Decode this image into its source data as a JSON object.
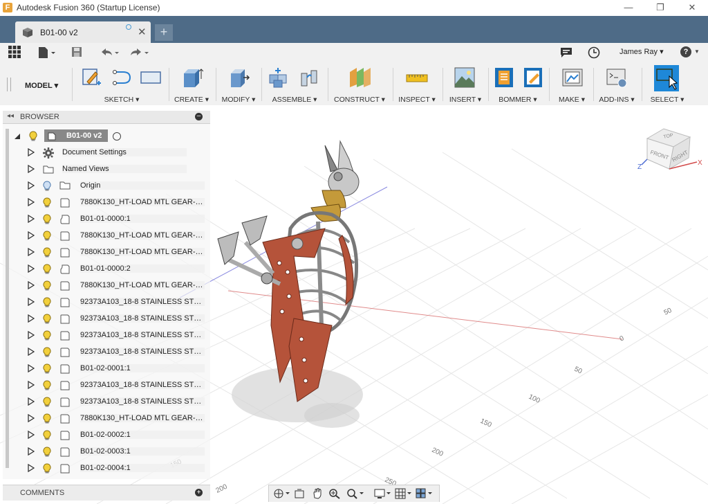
{
  "window": {
    "title": "Autodesk Fusion 360 (Startup License)",
    "app_letter": "F",
    "minimize": "—",
    "maximize": "❐",
    "close": "✕"
  },
  "tab": {
    "label": "B01-00 v2",
    "close": "✕",
    "new": "+"
  },
  "user": {
    "name": "James Ray ▾",
    "help": "?"
  },
  "workspace": {
    "label": "MODEL ▾"
  },
  "toolbar": {
    "sketch": "SKETCH ▾",
    "create": "CREATE ▾",
    "modify": "MODIFY ▾",
    "assemble": "ASSEMBLE ▾",
    "construct": "CONSTRUCT ▾",
    "inspect": "INSPECT ▾",
    "insert": "INSERT ▾",
    "bommer": "BOMMER ▾",
    "make": "MAKE ▾",
    "addins": "ADD-INS ▾",
    "select": "SELECT ▾"
  },
  "browser": {
    "title": "BROWSER",
    "root": "B01-00 v2",
    "items": [
      {
        "label": "Document Settings"
      },
      {
        "label": "Named Views"
      },
      {
        "label": "Origin"
      },
      {
        "label": "7880K130_HT-LOAD MTL GEAR--2..."
      },
      {
        "label": "B01-01-0000:1"
      },
      {
        "label": "7880K130_HT-LOAD MTL GEAR--2..."
      },
      {
        "label": "7880K130_HT-LOAD MTL GEAR--2..."
      },
      {
        "label": "B01-01-0000:2"
      },
      {
        "label": "7880K130_HT-LOAD MTL GEAR--2..."
      },
      {
        "label": "92373A103_18-8 STAINLESS STE..."
      },
      {
        "label": "92373A103_18-8 STAINLESS STE..."
      },
      {
        "label": "92373A103_18-8 STAINLESS STE..."
      },
      {
        "label": "92373A103_18-8 STAINLESS STE..."
      },
      {
        "label": "B01-02-0001:1"
      },
      {
        "label": "92373A103_18-8 STAINLESS STE..."
      },
      {
        "label": "92373A103_18-8 STAINLESS STE..."
      },
      {
        "label": "7880K130_HT-LOAD MTL GEAR--2..."
      },
      {
        "label": "B01-02-0002:1"
      },
      {
        "label": "B01-02-0003:1"
      },
      {
        "label": "B01-02-0004:1"
      }
    ]
  },
  "comments": {
    "title": "COMMENTS"
  },
  "viewcube": {
    "top": "TOP",
    "front": "FRONT",
    "right": "RIGHT",
    "x": "X",
    "z": "Z"
  },
  "grid_labels": [
    "50",
    "0",
    "50",
    "100",
    "150",
    "200",
    "250",
    "150",
    "200"
  ],
  "colors": {
    "tabbar": "#4e6b87",
    "accent": "#1e88d8",
    "part_red": "#b5533a",
    "part_grey": "#a8a8a8"
  }
}
